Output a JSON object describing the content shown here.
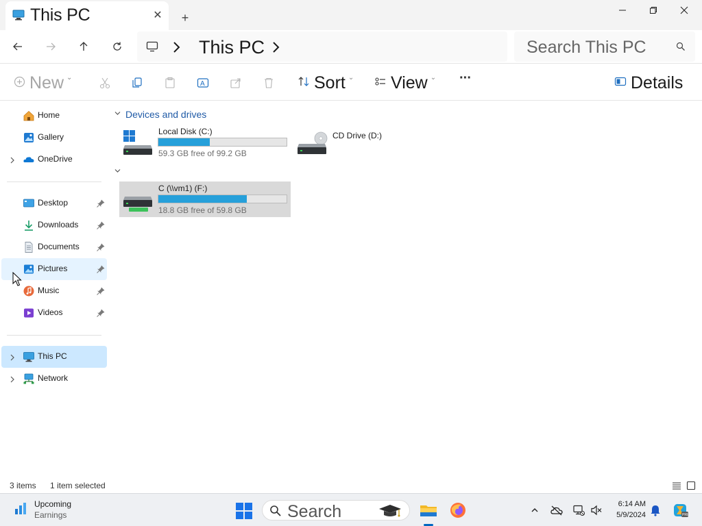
{
  "window": {
    "tab_title": "This PC",
    "tab_close": "✕",
    "new_tab": "+"
  },
  "address": {
    "path_text": "This PC",
    "search_placeholder": "Search This PC"
  },
  "commandbar": {
    "new_label": "New",
    "sort_label": "Sort",
    "view_label": "View",
    "more_label": "···",
    "details_label": "Details"
  },
  "sidebar": {
    "items": [
      {
        "label": "Home",
        "icon": "home-icon"
      },
      {
        "label": "Gallery",
        "icon": "gallery-icon"
      },
      {
        "label": "OneDrive",
        "icon": "onedrive-icon"
      },
      {
        "label": "Desktop",
        "icon": "desktop-folder-icon"
      },
      {
        "label": "Downloads",
        "icon": "downloads-icon"
      },
      {
        "label": "Documents",
        "icon": "documents-icon"
      },
      {
        "label": "Pictures",
        "icon": "pictures-icon"
      },
      {
        "label": "Music",
        "icon": "music-icon"
      },
      {
        "label": "Videos",
        "icon": "videos-icon"
      },
      {
        "label": "This PC",
        "icon": "this-pc-icon"
      },
      {
        "label": "Network",
        "icon": "network-icon"
      }
    ]
  },
  "content": {
    "group_devices": "Devices and drives",
    "drives": [
      {
        "name": "Local Disk (C:)",
        "free": "59.3 GB free of 99.2 GB",
        "used_fraction": 0.4
      },
      {
        "name": "CD Drive (D:)"
      },
      {
        "name": "C (\\\\vm1) (F:)",
        "free": "18.8 GB free of 59.8 GB",
        "used_fraction": 0.69
      }
    ]
  },
  "status": {
    "items_count": "3 items",
    "selection": "1 item selected"
  },
  "taskbar": {
    "weather_title": "Upcoming",
    "weather_sub": "Earnings",
    "search_label": "Search",
    "time": "6:14 AM",
    "date": "5/9/2024"
  },
  "colors": {
    "accent": "#0067c0",
    "drive_bar": "#26a0da",
    "selected_nav": "#cce8ff",
    "group_header": "#1f5aa6"
  }
}
